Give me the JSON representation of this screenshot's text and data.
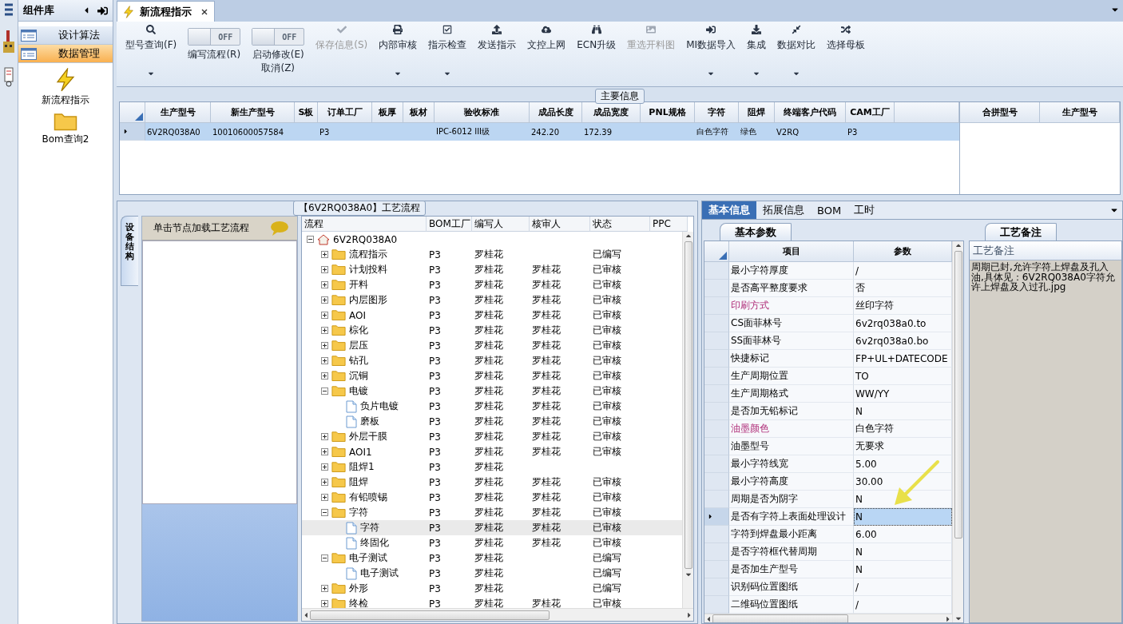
{
  "component_library": {
    "title": "组件库",
    "categories": [
      {
        "label": "设计算法",
        "selected": false
      },
      {
        "label": "数据管理",
        "selected": true
      }
    ],
    "items": [
      {
        "label": "新流程指示",
        "kind": "lightning"
      },
      {
        "label": "Bom查询2",
        "kind": "folder"
      }
    ]
  },
  "document_tab": {
    "title": "新流程指示",
    "selected": true
  },
  "toolbar": [
    {
      "kind": "button",
      "label": "型号查询(F)",
      "has_menu": true,
      "disabled": false
    },
    {
      "kind": "toggle",
      "label": "编写流程(R)",
      "toggle_text": "OFF",
      "on": false
    },
    {
      "kind": "toggle",
      "label": "启动修改(E)",
      "label2": "取消(Z)",
      "toggle_text": "OFF",
      "on": false
    },
    {
      "kind": "button",
      "label": "保存信息(S)",
      "has_menu": false,
      "disabled": true
    },
    {
      "kind": "button",
      "label": "内部审核",
      "has_menu": true,
      "disabled": false
    },
    {
      "kind": "button",
      "label": "指示检查",
      "has_menu": true,
      "disabled": false
    },
    {
      "kind": "button",
      "label": "发送指示",
      "has_menu": false,
      "disabled": false
    },
    {
      "kind": "button",
      "label": "文控上网",
      "has_menu": false,
      "disabled": false
    },
    {
      "kind": "button",
      "label": "ECN升级",
      "has_menu": false,
      "disabled": false
    },
    {
      "kind": "button",
      "label": "重选开料图",
      "has_menu": false,
      "disabled": true
    },
    {
      "kind": "button",
      "label": "MI数据导入",
      "has_menu": true,
      "disabled": false
    },
    {
      "kind": "button",
      "label": "集成",
      "has_menu": true,
      "disabled": false
    },
    {
      "kind": "button",
      "label": "数据对比",
      "has_menu": true,
      "disabled": false
    },
    {
      "kind": "button",
      "label": "选择母板",
      "has_menu": false,
      "disabled": false
    }
  ],
  "main_info": {
    "title": "主要信息",
    "columns": [
      "生产型号",
      "新生产型号",
      "S板",
      "订单工厂",
      "板厚",
      "板材",
      "验收标准",
      "成品长度",
      "成品宽度",
      "PNL规格",
      "字符",
      "阻焊",
      "终端客户代码",
      "CAM工厂"
    ],
    "rows": [
      {
        "selected": true,
        "cells": [
          "6V2RQ038A0",
          "10010600057584",
          "",
          "P3",
          "",
          "",
          "IPC-6012 III级",
          "242.20",
          "172.39",
          "",
          "白色字符",
          "绿色",
          "V2RQ",
          "P3"
        ]
      }
    ],
    "merge_columns": [
      "合拼型号",
      "生产型号"
    ]
  },
  "process_flow": {
    "title": "【6V2RQ038A0】工艺流程",
    "side_tab": "设备结构",
    "hint": "单击节点加载工艺流程",
    "columns": [
      "流程",
      "BOM工厂",
      "编写人",
      "核审人",
      "状态",
      "PPC"
    ],
    "tree": [
      {
        "label": "6V2RQ038A0",
        "kind": "root",
        "expanded": true,
        "selected": false,
        "cells": [
          "",
          "",
          "",
          ""
        ],
        "children": [
          {
            "label": "流程指示",
            "kind": "folder",
            "expanded": false,
            "selected": false,
            "cells": [
              "P3",
              "罗桂花",
              "",
              "已编写"
            ]
          },
          {
            "label": "计划投料",
            "kind": "folder",
            "expanded": false,
            "selected": false,
            "cells": [
              "P3",
              "罗桂花",
              "罗桂花",
              "已审核"
            ]
          },
          {
            "label": "开料",
            "kind": "folder",
            "expanded": false,
            "selected": false,
            "cells": [
              "P3",
              "罗桂花",
              "罗桂花",
              "已审核"
            ]
          },
          {
            "label": "内层图形",
            "kind": "folder",
            "expanded": false,
            "selected": false,
            "cells": [
              "P3",
              "罗桂花",
              "罗桂花",
              "已审核"
            ]
          },
          {
            "label": "AOI",
            "kind": "folder",
            "expanded": false,
            "selected": false,
            "cells": [
              "P3",
              "罗桂花",
              "罗桂花",
              "已审核"
            ]
          },
          {
            "label": "棕化",
            "kind": "folder",
            "expanded": false,
            "selected": false,
            "cells": [
              "P3",
              "罗桂花",
              "罗桂花",
              "已审核"
            ]
          },
          {
            "label": "层压",
            "kind": "folder",
            "expanded": false,
            "selected": false,
            "cells": [
              "P3",
              "罗桂花",
              "罗桂花",
              "已审核"
            ]
          },
          {
            "label": "钻孔",
            "kind": "folder",
            "expanded": false,
            "selected": false,
            "cells": [
              "P3",
              "罗桂花",
              "罗桂花",
              "已审核"
            ]
          },
          {
            "label": "沉铜",
            "kind": "folder",
            "expanded": false,
            "selected": false,
            "cells": [
              "P3",
              "罗桂花",
              "罗桂花",
              "已审核"
            ]
          },
          {
            "label": "电镀",
            "kind": "folder",
            "expanded": true,
            "selected": false,
            "cells": [
              "P3",
              "罗桂花",
              "罗桂花",
              "已审核"
            ],
            "children": [
              {
                "label": "负片电镀",
                "kind": "file",
                "selected": false,
                "cells": [
                  "P3",
                  "罗桂花",
                  "罗桂花",
                  "已审核"
                ]
              },
              {
                "label": "磨板",
                "kind": "file",
                "selected": false,
                "cells": [
                  "P3",
                  "罗桂花",
                  "罗桂花",
                  "已审核"
                ]
              }
            ]
          },
          {
            "label": "外层干膜",
            "kind": "folder",
            "expanded": false,
            "selected": false,
            "cells": [
              "P3",
              "罗桂花",
              "罗桂花",
              "已审核"
            ]
          },
          {
            "label": "AOI1",
            "kind": "folder",
            "expanded": false,
            "selected": false,
            "cells": [
              "P3",
              "罗桂花",
              "罗桂花",
              "已审核"
            ]
          },
          {
            "label": "阻焊1",
            "kind": "folder",
            "expanded": false,
            "selected": false,
            "cells": [
              "P3",
              "罗桂花",
              "",
              ""
            ]
          },
          {
            "label": "阻焊",
            "kind": "folder",
            "expanded": false,
            "selected": false,
            "cells": [
              "P3",
              "罗桂花",
              "罗桂花",
              "已审核"
            ]
          },
          {
            "label": "有铅喷锡",
            "kind": "folder",
            "expanded": false,
            "selected": false,
            "cells": [
              "P3",
              "罗桂花",
              "罗桂花",
              "已审核"
            ]
          },
          {
            "label": "字符",
            "kind": "folder",
            "expanded": true,
            "selected": false,
            "cells": [
              "P3",
              "罗桂花",
              "罗桂花",
              "已审核"
            ],
            "children": [
              {
                "label": "字符",
                "kind": "file",
                "selected": true,
                "cells": [
                  "P3",
                  "罗桂花",
                  "罗桂花",
                  "已审核"
                ]
              },
              {
                "label": "终固化",
                "kind": "file",
                "selected": false,
                "cells": [
                  "P3",
                  "罗桂花",
                  "罗桂花",
                  "已审核"
                ]
              }
            ]
          },
          {
            "label": "电子测试",
            "kind": "folder",
            "expanded": true,
            "selected": false,
            "cells": [
              "P3",
              "罗桂花",
              "",
              "已编写"
            ],
            "children": [
              {
                "label": "电子测试",
                "kind": "file",
                "selected": false,
                "cells": [
                  "P3",
                  "罗桂花",
                  "",
                  "已编写"
                ]
              }
            ]
          },
          {
            "label": "外形",
            "kind": "folder",
            "expanded": false,
            "selected": false,
            "cells": [
              "P3",
              "罗桂花",
              "",
              "已编写"
            ]
          },
          {
            "label": "终检",
            "kind": "folder",
            "expanded": false,
            "selected": false,
            "cells": [
              "P3",
              "罗桂花",
              "罗桂花",
              "已审核"
            ]
          }
        ]
      }
    ]
  },
  "detail_tabs": [
    {
      "label": "基本信息",
      "selected": true
    },
    {
      "label": "拓展信息",
      "selected": false
    },
    {
      "label": "BOM",
      "selected": false
    },
    {
      "label": "工时",
      "selected": false
    }
  ],
  "parameters": {
    "tab": "基本参数",
    "columns": [
      "项目",
      "参数"
    ],
    "rows": [
      {
        "item": "最小字符厚度",
        "value": "/",
        "emphasized": false,
        "selected": false
      },
      {
        "item": "是否高平整度要求",
        "value": "否",
        "emphasized": false,
        "selected": false
      },
      {
        "item": "印刷方式",
        "value": "丝印字符",
        "emphasized": true,
        "selected": false
      },
      {
        "item": "CS面菲林号",
        "value": "6v2rq038a0.to",
        "emphasized": false,
        "selected": false
      },
      {
        "item": "SS面菲林号",
        "value": "6v2rq038a0.bo",
        "emphasized": false,
        "selected": false
      },
      {
        "item": "快捷标记",
        "value": "FP+UL+DATECODE",
        "emphasized": false,
        "selected": false
      },
      {
        "item": "生产周期位置",
        "value": "TO",
        "emphasized": false,
        "selected": false
      },
      {
        "item": "生产周期格式",
        "value": "WW/YY",
        "emphasized": false,
        "selected": false
      },
      {
        "item": "是否加无铅标记",
        "value": "N",
        "emphasized": false,
        "selected": false
      },
      {
        "item": "油墨颜色",
        "value": "白色字符",
        "emphasized": true,
        "selected": false
      },
      {
        "item": "油墨型号",
        "value": "无要求",
        "emphasized": false,
        "selected": false
      },
      {
        "item": "最小字符线宽",
        "value": "5.00",
        "emphasized": false,
        "selected": false
      },
      {
        "item": "最小字符高度",
        "value": "30.00",
        "emphasized": false,
        "selected": false
      },
      {
        "item": "周期是否为阴字",
        "value": "N",
        "emphasized": false,
        "selected": false
      },
      {
        "item": "是否有字符上表面处理设计",
        "value": "N",
        "emphasized": false,
        "selected": true
      },
      {
        "item": "字符到焊盘最小距离",
        "value": "6.00",
        "emphasized": false,
        "selected": false
      },
      {
        "item": "是否字符框代替周期",
        "value": "N",
        "emphasized": false,
        "selected": false
      },
      {
        "item": "是否加生产型号",
        "value": "N",
        "emphasized": false,
        "selected": false
      },
      {
        "item": "识别码位置图纸",
        "value": "/",
        "emphasized": false,
        "selected": false
      },
      {
        "item": "二维码位置图纸",
        "value": "/",
        "emphasized": false,
        "selected": false
      }
    ]
  },
  "notes": {
    "tab": "工艺备注",
    "header": "工艺备注",
    "text": "周期已封,允许字符上焊盘及孔入油,具体见：6V2RQ038A0字符允许上焊盘及入过孔.jpg"
  }
}
